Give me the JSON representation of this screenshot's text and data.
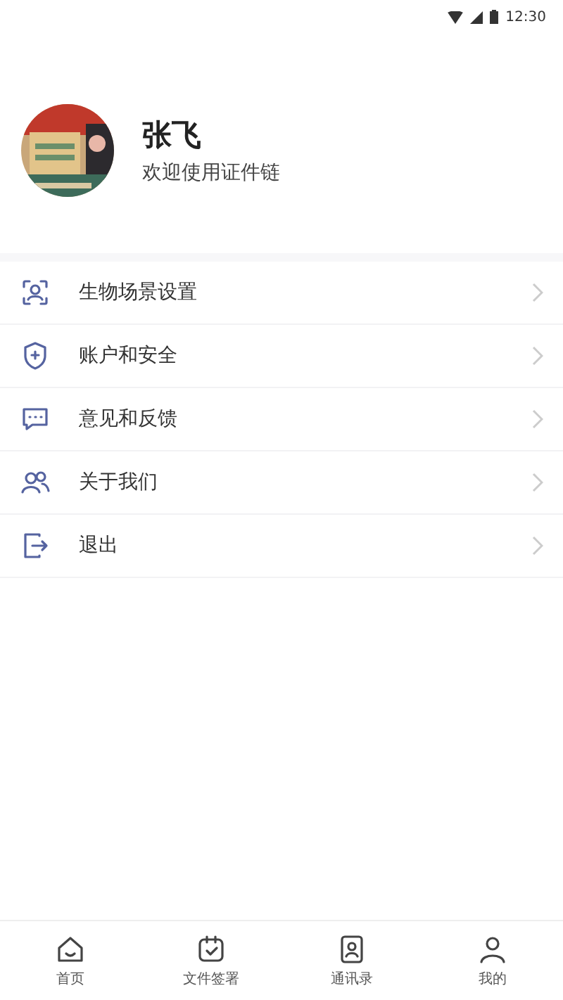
{
  "status_bar": {
    "time": "12:30"
  },
  "profile": {
    "name": "张飞",
    "subtitle": "欢迎使用证件链"
  },
  "menu": [
    {
      "kind": "face",
      "label": "生物场景设置"
    },
    {
      "kind": "shield",
      "label": "账户和安全"
    },
    {
      "kind": "chat",
      "label": "意见和反馈"
    },
    {
      "kind": "people",
      "label": "关于我们"
    },
    {
      "kind": "exit",
      "label": "退出"
    }
  ],
  "tab_bar": [
    {
      "kind": "home",
      "label": "首页"
    },
    {
      "kind": "sign",
      "label": "文件签署"
    },
    {
      "kind": "contacts",
      "label": "通讯录"
    },
    {
      "kind": "me",
      "label": "我的"
    }
  ]
}
